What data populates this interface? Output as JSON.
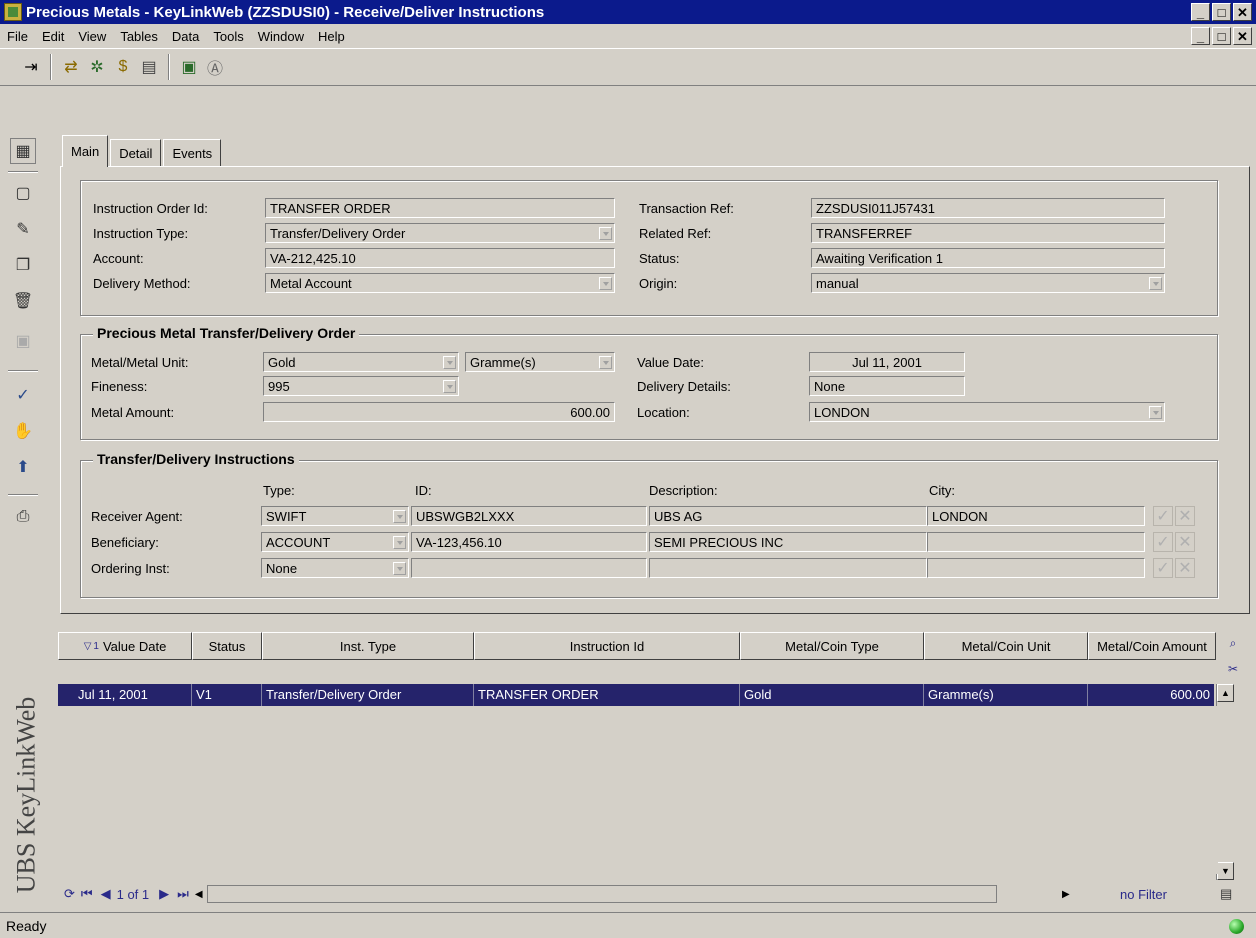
{
  "window": {
    "title": "Precious Metals - KeyLinkWeb (ZZSDUSI0) - Receive/Deliver Instructions"
  },
  "menu": [
    "File",
    "Edit",
    "View",
    "Tables",
    "Data",
    "Tools",
    "Window",
    "Help"
  ],
  "tabs": [
    "Main",
    "Detail",
    "Events"
  ],
  "main": {
    "instruction_order_id_label": "Instruction Order Id:",
    "instruction_order_id": "TRANSFER ORDER",
    "instruction_type_label": "Instruction Type:",
    "instruction_type": "Transfer/Delivery Order",
    "account_label": "Account:",
    "account": "VA-212,425.10",
    "delivery_method_label": "Delivery Method:",
    "delivery_method": "Metal Account",
    "transaction_ref_label": "Transaction Ref:",
    "transaction_ref": "ZZSDUSI011J57431",
    "related_ref_label": "Related Ref:",
    "related_ref": "TRANSFERREF",
    "status_label": "Status:",
    "status": "Awaiting Verification 1",
    "origin_label": "Origin:",
    "origin": "manual"
  },
  "metal_order": {
    "title": "Precious Metal Transfer/Delivery Order",
    "metal_unit_label": "Metal/Metal Unit:",
    "metal": "Gold",
    "unit": "Gramme(s)",
    "fineness_label": "Fineness:",
    "fineness": "995",
    "metal_amount_label": "Metal Amount:",
    "metal_amount": "600.00",
    "value_date_label": "Value Date:",
    "value_date": "Jul 11, 2001",
    "delivery_details_label": "Delivery Details:",
    "delivery_details": "None",
    "location_label": "Location:",
    "location": "LONDON"
  },
  "instructions": {
    "title": "Transfer/Delivery Instructions",
    "col_type": "Type:",
    "col_id": "ID:",
    "col_description": "Description:",
    "col_city": "City:",
    "rows": [
      {
        "label": "Receiver Agent:",
        "type": "SWIFT",
        "id": "UBSWGB2LXXX",
        "description": "UBS AG",
        "city": "LONDON"
      },
      {
        "label": "Beneficiary:",
        "type": "ACCOUNT",
        "id": "VA-123,456.10",
        "description": "SEMI PRECIOUS INC",
        "city": ""
      },
      {
        "label": "Ordering Inst:",
        "type": "None",
        "id": "",
        "description": "",
        "city": ""
      }
    ]
  },
  "grid": {
    "sort_marker": "1",
    "headers": [
      "Value Date",
      "Status",
      "Inst. Type",
      "Instruction Id",
      "Metal/Coin Type",
      "Metal/Coin Unit",
      "Metal/Coin Amount"
    ],
    "row": {
      "value_date": "Jul 11, 2001",
      "status": "V1",
      "inst_type": "Transfer/Delivery Order",
      "instruction_id": "TRANSFER ORDER",
      "metal_type": "Gold",
      "metal_unit": "Gramme(s)",
      "amount": "600.00"
    },
    "page": "1 of 1",
    "filter": "no Filter"
  },
  "brand": "UBS KeyLinkWeb",
  "status_bar": "Ready",
  "colors": {
    "titlebar": "#0b1a8c",
    "selected_row": "#25236b",
    "chrome": "#d4d0c8"
  }
}
